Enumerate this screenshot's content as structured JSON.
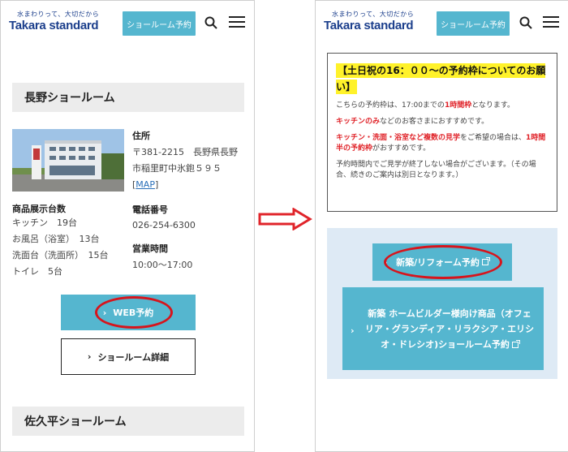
{
  "left": {
    "logo_tagline": "水まわりって、大切だから",
    "logo_brand": "Takara standard",
    "header_button": "ショールーム予約",
    "section_title": "長野ショールーム",
    "address_label": "住所",
    "address_line1": "〒381-2215　長野県長野",
    "address_line2": "市稲里町中氷鉋５９５",
    "map_bracket_open": "[",
    "map_link": "MAP",
    "map_bracket_close": "]",
    "exhibits_label": "商品展示台数",
    "exhibits": [
      "キッチン　19台",
      "お風呂（浴室）　13台",
      "洗面台（洗面所）　15台",
      "トイレ　5台"
    ],
    "phone_label": "電話番号",
    "phone": "026-254-6300",
    "hours_label": "営業時間",
    "hours": "10:00〜17:00",
    "web_reserve_button": "WEB予約",
    "detail_button": "ショールーム詳細",
    "next_section_title": "佐久平ショールーム"
  },
  "right": {
    "logo_tagline": "水まわりって、大切だから",
    "logo_brand": "Takara standard",
    "header_button": "ショールーム予約",
    "notice_title": "【土日祝の16：００〜の予約枠についてのお願い】",
    "notice_p1_a": "こちらの予約枠は、17:00までの",
    "notice_p1_b": "1時間枠",
    "notice_p1_c": "となります。",
    "notice_p2_a": "キッチンのみ",
    "notice_p2_b": "などのお客さまにおすすめです。",
    "notice_p3_a": "キッチン・洗面・浴室など複数の見学",
    "notice_p3_b": "をご希望の場合は、",
    "notice_p3_c": "1時間半の予約枠",
    "notice_p3_d": "がおすすめです。",
    "notice_p4": "予約時間内でご見学が終了しない場合がございます。（その場合、続きのご案内は別日となります。）",
    "reform_button": "新築/リフォーム予約",
    "builder_button": "新築 ホームビルダー様向け商品（オフェリア・グランディア・リラクシア・エリシオ・ドレシオ)ショールーム予約"
  },
  "colors": {
    "accent": "#55b6cf",
    "brand": "#1c3f8c",
    "highlight_red": "#d7141c",
    "notice_yellow": "#fff22a",
    "panel_blue": "#deeaf5"
  }
}
